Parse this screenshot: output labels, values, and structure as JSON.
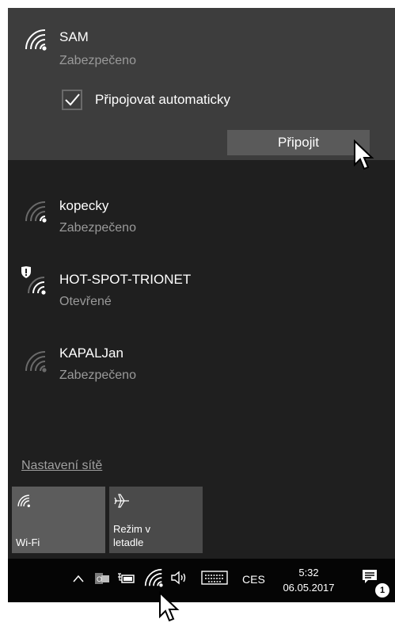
{
  "networks": {
    "selected": {
      "ssid": "SAM",
      "status": "Zabezpečeno",
      "auto_connect_label": "Připojovat automaticky",
      "auto_connect_checked": true,
      "connect_label": "Připojit"
    },
    "items": [
      {
        "ssid": "kopecky",
        "status": "Zabezpečeno"
      },
      {
        "ssid": "HOT-SPOT-TRIONET",
        "status": "Otevřené"
      },
      {
        "ssid": "KAPALJan",
        "status": "Zabezpečeno"
      }
    ]
  },
  "settings_link": "Nastavení sítě",
  "quick_actions": [
    {
      "label": "Wi-Fi",
      "icon": "wifi-icon",
      "active": true
    },
    {
      "label": "Režim v letadle",
      "icon": "airplane-icon",
      "active": false
    }
  ],
  "taskbar": {
    "language": "CES",
    "time": "5:32",
    "date": "06.05.2017",
    "notification_count": "1"
  },
  "colors": {
    "flyout_bg": "#1f1f1f",
    "selected_bg": "#3d3d3d",
    "connect_button": "#5a5a5a",
    "taskbar_bg": "#050505"
  }
}
